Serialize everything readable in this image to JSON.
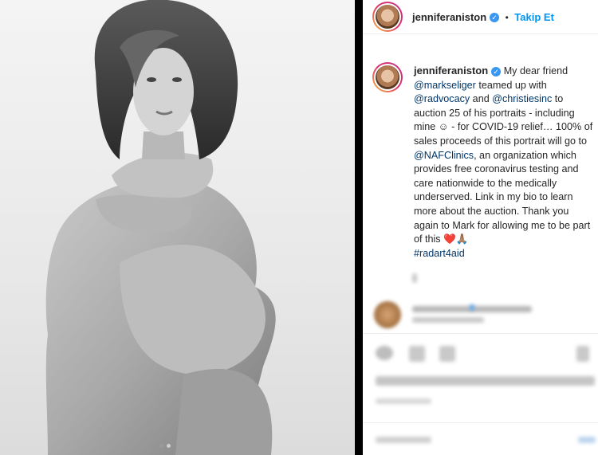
{
  "post": {
    "username": "jenniferaniston",
    "verified_glyph": "✓",
    "separator": "•",
    "follow_label": "Takip Et"
  },
  "caption": {
    "username": "jenniferaniston",
    "line1_text": "My dear friend",
    "mention1": "@markseliger",
    "line2_text": " teamed up with",
    "mention2": "@radvocacy",
    "and_text": " and ",
    "mention3": "@christiesinc",
    "to_text": " to",
    "body1": "auction 25 of his portraits - including mine ☺ - for COVID-19 relief… 100% of sales proceeds of this portrait will go to ",
    "mention4": "@NAFClinics",
    "body2": ", an organization which provides free coronavirus testing and care nationwide to the medically underserved. Link in my bio to learn more about the auction. Thank you again to Mark for allowing me to be part of this ",
    "emoji": "❤️🙏🏽",
    "hashtag": "#radart4aid"
  },
  "carousel": {
    "count": 2,
    "active": 1
  },
  "icons": [
    "verified-icon",
    "heart-icon",
    "comment-icon",
    "share-icon",
    "bookmark-icon"
  ]
}
